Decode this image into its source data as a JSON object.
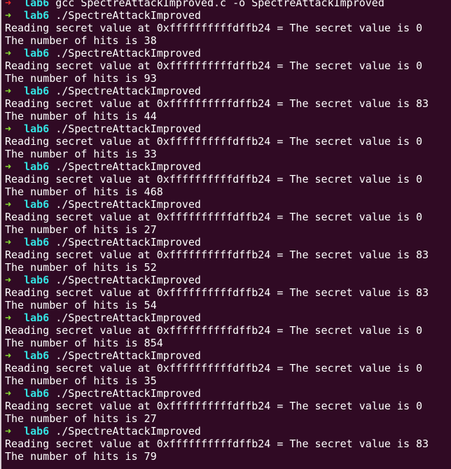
{
  "terminal": {
    "prompt_arrow": "➜",
    "prompt_dir": "lab6",
    "colors": {
      "background": "#300a24",
      "foreground": "#ffffff",
      "arrow_success": "#8ae234",
      "arrow_error": "#ef2929",
      "directory": "#34e2e2"
    },
    "lines": [
      {
        "type": "prompt",
        "status": "error",
        "command": "gcc SpectreAttackImproved.c -o SpectreAttackImproved"
      },
      {
        "type": "prompt",
        "status": "ok",
        "command": "./SpectreAttackImproved"
      },
      {
        "type": "output",
        "text": "Reading secret value at 0xffffffffffdffb24 = The secret value is 0"
      },
      {
        "type": "output",
        "text": "The number of hits is 38"
      },
      {
        "type": "prompt",
        "status": "ok",
        "command": "./SpectreAttackImproved"
      },
      {
        "type": "output",
        "text": "Reading secret value at 0xffffffffffdffb24 = The secret value is 0"
      },
      {
        "type": "output",
        "text": "The number of hits is 93"
      },
      {
        "type": "prompt",
        "status": "ok",
        "command": "./SpectreAttackImproved"
      },
      {
        "type": "output",
        "text": "Reading secret value at 0xffffffffffdffb24 = The secret value is 83"
      },
      {
        "type": "output",
        "text": "The number of hits is 44"
      },
      {
        "type": "prompt",
        "status": "ok",
        "command": "./SpectreAttackImproved"
      },
      {
        "type": "output",
        "text": "Reading secret value at 0xffffffffffdffb24 = The secret value is 0"
      },
      {
        "type": "output",
        "text": "The number of hits is 33"
      },
      {
        "type": "prompt",
        "status": "ok",
        "command": "./SpectreAttackImproved"
      },
      {
        "type": "output",
        "text": "Reading secret value at 0xffffffffffdffb24 = The secret value is 0"
      },
      {
        "type": "output",
        "text": "The number of hits is 468"
      },
      {
        "type": "prompt",
        "status": "ok",
        "command": "./SpectreAttackImproved"
      },
      {
        "type": "output",
        "text": "Reading secret value at 0xffffffffffdffb24 = The secret value is 0"
      },
      {
        "type": "output",
        "text": "The number of hits is 27"
      },
      {
        "type": "prompt",
        "status": "ok",
        "command": "./SpectreAttackImproved"
      },
      {
        "type": "output",
        "text": "Reading secret value at 0xffffffffffdffb24 = The secret value is 83"
      },
      {
        "type": "output",
        "text": "The number of hits is 52"
      },
      {
        "type": "prompt",
        "status": "ok",
        "command": "./SpectreAttackImproved"
      },
      {
        "type": "output",
        "text": "Reading secret value at 0xffffffffffdffb24 = The secret value is 83"
      },
      {
        "type": "output",
        "text": "The number of hits is 54"
      },
      {
        "type": "prompt",
        "status": "ok",
        "command": "./SpectreAttackImproved"
      },
      {
        "type": "output",
        "text": "Reading secret value at 0xffffffffffdffb24 = The secret value is 0"
      },
      {
        "type": "output",
        "text": "The number of hits is 854"
      },
      {
        "type": "prompt",
        "status": "ok",
        "command": "./SpectreAttackImproved"
      },
      {
        "type": "output",
        "text": "Reading secret value at 0xffffffffffdffb24 = The secret value is 0"
      },
      {
        "type": "output",
        "text": "The number of hits is 35"
      },
      {
        "type": "prompt",
        "status": "ok",
        "command": "./SpectreAttackImproved"
      },
      {
        "type": "output",
        "text": "Reading secret value at 0xffffffffffdffb24 = The secret value is 0"
      },
      {
        "type": "output",
        "text": "The number of hits is 27"
      },
      {
        "type": "prompt",
        "status": "ok",
        "command": "./SpectreAttackImproved"
      },
      {
        "type": "output",
        "text": "Reading secret value at 0xffffffffffdffb24 = The secret value is 83"
      },
      {
        "type": "output",
        "text": "The number of hits is 79"
      }
    ]
  }
}
